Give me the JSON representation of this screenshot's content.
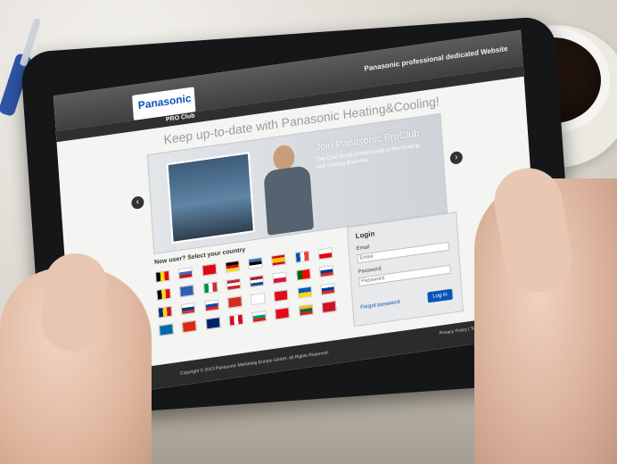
{
  "scene": {
    "description": "",
    "colors": {
      "tablet_bezel": "#151617",
      "panasonic_blue": "#0a55b7",
      "site_dark": "#2b2b2b"
    }
  },
  "site": {
    "header": {
      "logo_text": "Panasonic",
      "tagline": "Panasonic professional dedicated Website"
    },
    "subheader": {
      "proclub_label": "PRO Club"
    },
    "hero": {
      "headline": "Keep up-to-date with Panasonic Heating&Cooling!",
      "banner_title": "Join Panasonic ProClub",
      "banner_subtitle": "The Club for all professionals in the Heating and Cooling Business",
      "left_arrow_icon": "chevron-left-icon",
      "right_arrow_icon": "chevron-right-icon"
    },
    "country_selector": {
      "title": "New user? Select your country",
      "flags": [
        "flag-1",
        "flag-2",
        "flag-3",
        "flag-4",
        "flag-5",
        "flag-6",
        "flag-7",
        "flag-8",
        "flag-9",
        "flag-10",
        "flag-11",
        "flag-12",
        "flag-13",
        "flag-14",
        "flag-15",
        "flag-16",
        "flag-17",
        "flag-18",
        "flag-19",
        "flag-20",
        "flag-21",
        "flag-22",
        "flag-23",
        "flag-24",
        "flag-25",
        "flag-26",
        "flag-27",
        "flag-28",
        "flag-29",
        "flag-30",
        "flag-31",
        "flag-32"
      ]
    },
    "login": {
      "title": "Login",
      "email_label": "Email",
      "email_placeholder": "Email",
      "password_label": "Password",
      "password_placeholder": "Password",
      "forgot_link": "Forgot password",
      "login_button": "Log in"
    },
    "footer": {
      "copyright": "Copyright © 2013 Panasonic Marketing Europe GmbH. All Rights Reserved.",
      "links": "Privacy Policy | Terms of Use"
    }
  }
}
